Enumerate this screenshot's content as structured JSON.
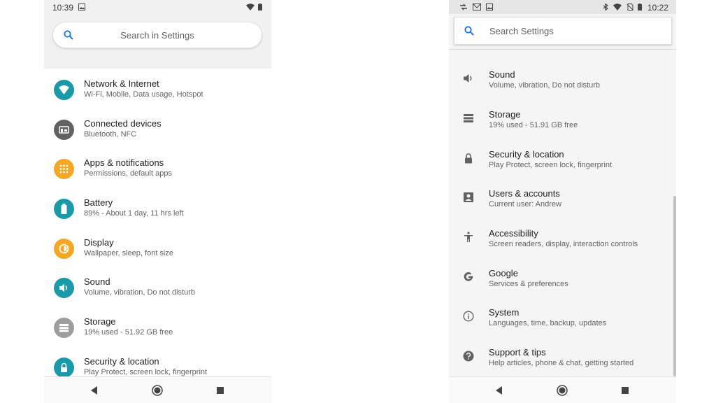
{
  "left": {
    "status_time": "10:39",
    "search_placeholder": "Search in Settings",
    "items": [
      {
        "title": "Network & Internet",
        "summary": "Wi-Fi, Mobile, Data usage, Hotspot",
        "icon": "wifi-icon",
        "color": "#1a9aa8"
      },
      {
        "title": "Connected devices",
        "summary": "Bluetooth, NFC",
        "icon": "devices-icon",
        "color": "#626262"
      },
      {
        "title": "Apps & notifications",
        "summary": "Permissions, default apps",
        "icon": "apps-grid-icon",
        "color": "#f5a623"
      },
      {
        "title": "Battery",
        "summary": "89% - About 1 day, 11 hrs left",
        "icon": "battery-icon",
        "color": "#1a9aa8"
      },
      {
        "title": "Display",
        "summary": "Wallpaper, sleep, font size",
        "icon": "brightness-icon",
        "color": "#f5a623"
      },
      {
        "title": "Sound",
        "summary": "Volume, vibration, Do not disturb",
        "icon": "volume-icon",
        "color": "#1a9aa8"
      },
      {
        "title": "Storage",
        "summary": "19% used - 51.92 GB free",
        "icon": "storage-icon",
        "color": "#9e9e9e"
      },
      {
        "title": "Security & location",
        "summary": "Play Protect, screen lock, fingerprint",
        "icon": "lock-icon",
        "color": "#1a9aa8"
      }
    ]
  },
  "right": {
    "status_time": "10:22",
    "search_placeholder": "Search Settings",
    "items": [
      {
        "title": "Sound",
        "summary": "Volume, vibration, Do not disturb",
        "icon": "volume-icon"
      },
      {
        "title": "Storage",
        "summary": "19% used - 51.91 GB free",
        "icon": "storage-icon"
      },
      {
        "title": "Security & location",
        "summary": "Play Protect, screen lock, fingerprint",
        "icon": "lock-icon"
      },
      {
        "title": "Users & accounts",
        "summary": "Current user: Andrew",
        "icon": "account-box-icon"
      },
      {
        "title": "Accessibility",
        "summary": "Screen readers, display, interaction controls",
        "icon": "accessibility-icon"
      },
      {
        "title": "Google",
        "summary": "Services & preferences",
        "icon": "google-icon"
      },
      {
        "title": "System",
        "summary": "Languages, time, backup, updates",
        "icon": "info-icon"
      },
      {
        "title": "Support & tips",
        "summary": "Help articles, phone & chat, getting started",
        "icon": "help-icon"
      }
    ]
  },
  "colors": {
    "teal": "#1a9aa8",
    "orange": "#f5a623",
    "grey_icon": "#626262",
    "mono_icon": "#616161"
  }
}
